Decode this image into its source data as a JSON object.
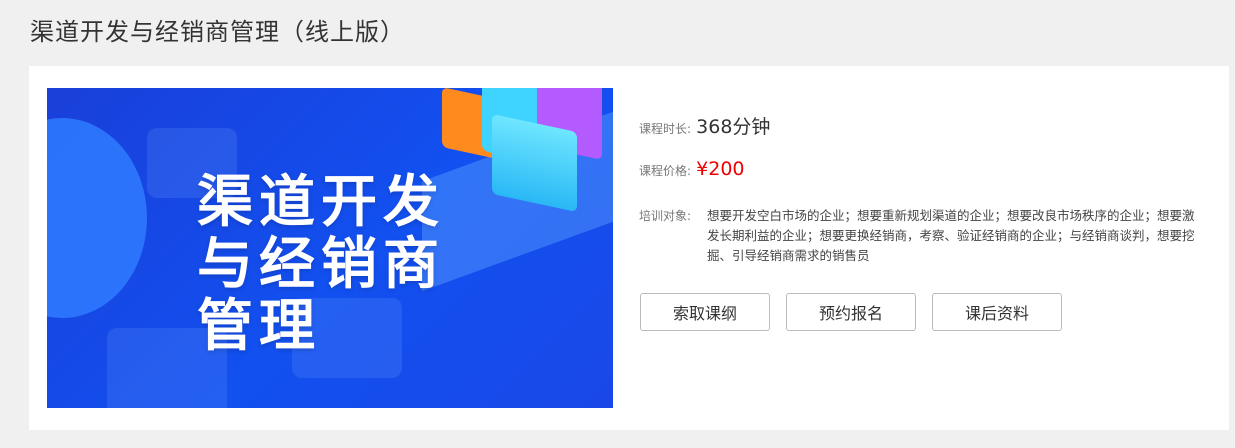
{
  "page": {
    "title": "渠道开发与经销商管理（线上版）"
  },
  "course": {
    "banner_title": "渠道开发与经销商管理",
    "duration_label": "课程时长:",
    "duration_value": "368分钟",
    "price_label": "课程价格:",
    "price_value": "¥200",
    "target_label": "培训对象:",
    "target_value": "想要开发空白市场的企业；想要重新规划渠道的企业；想要改良市场秩序的企业；想要激发长期利益的企业；想要更换经销商，考察、验证经销商的企业；与经销商谈判，想要挖掘、引导经销商需求的销售员"
  },
  "buttons": {
    "outline": "索取课纲",
    "register": "预约报名",
    "materials": "课后资料"
  },
  "colors": {
    "price": "#e00000",
    "banner": "#1250f0"
  }
}
